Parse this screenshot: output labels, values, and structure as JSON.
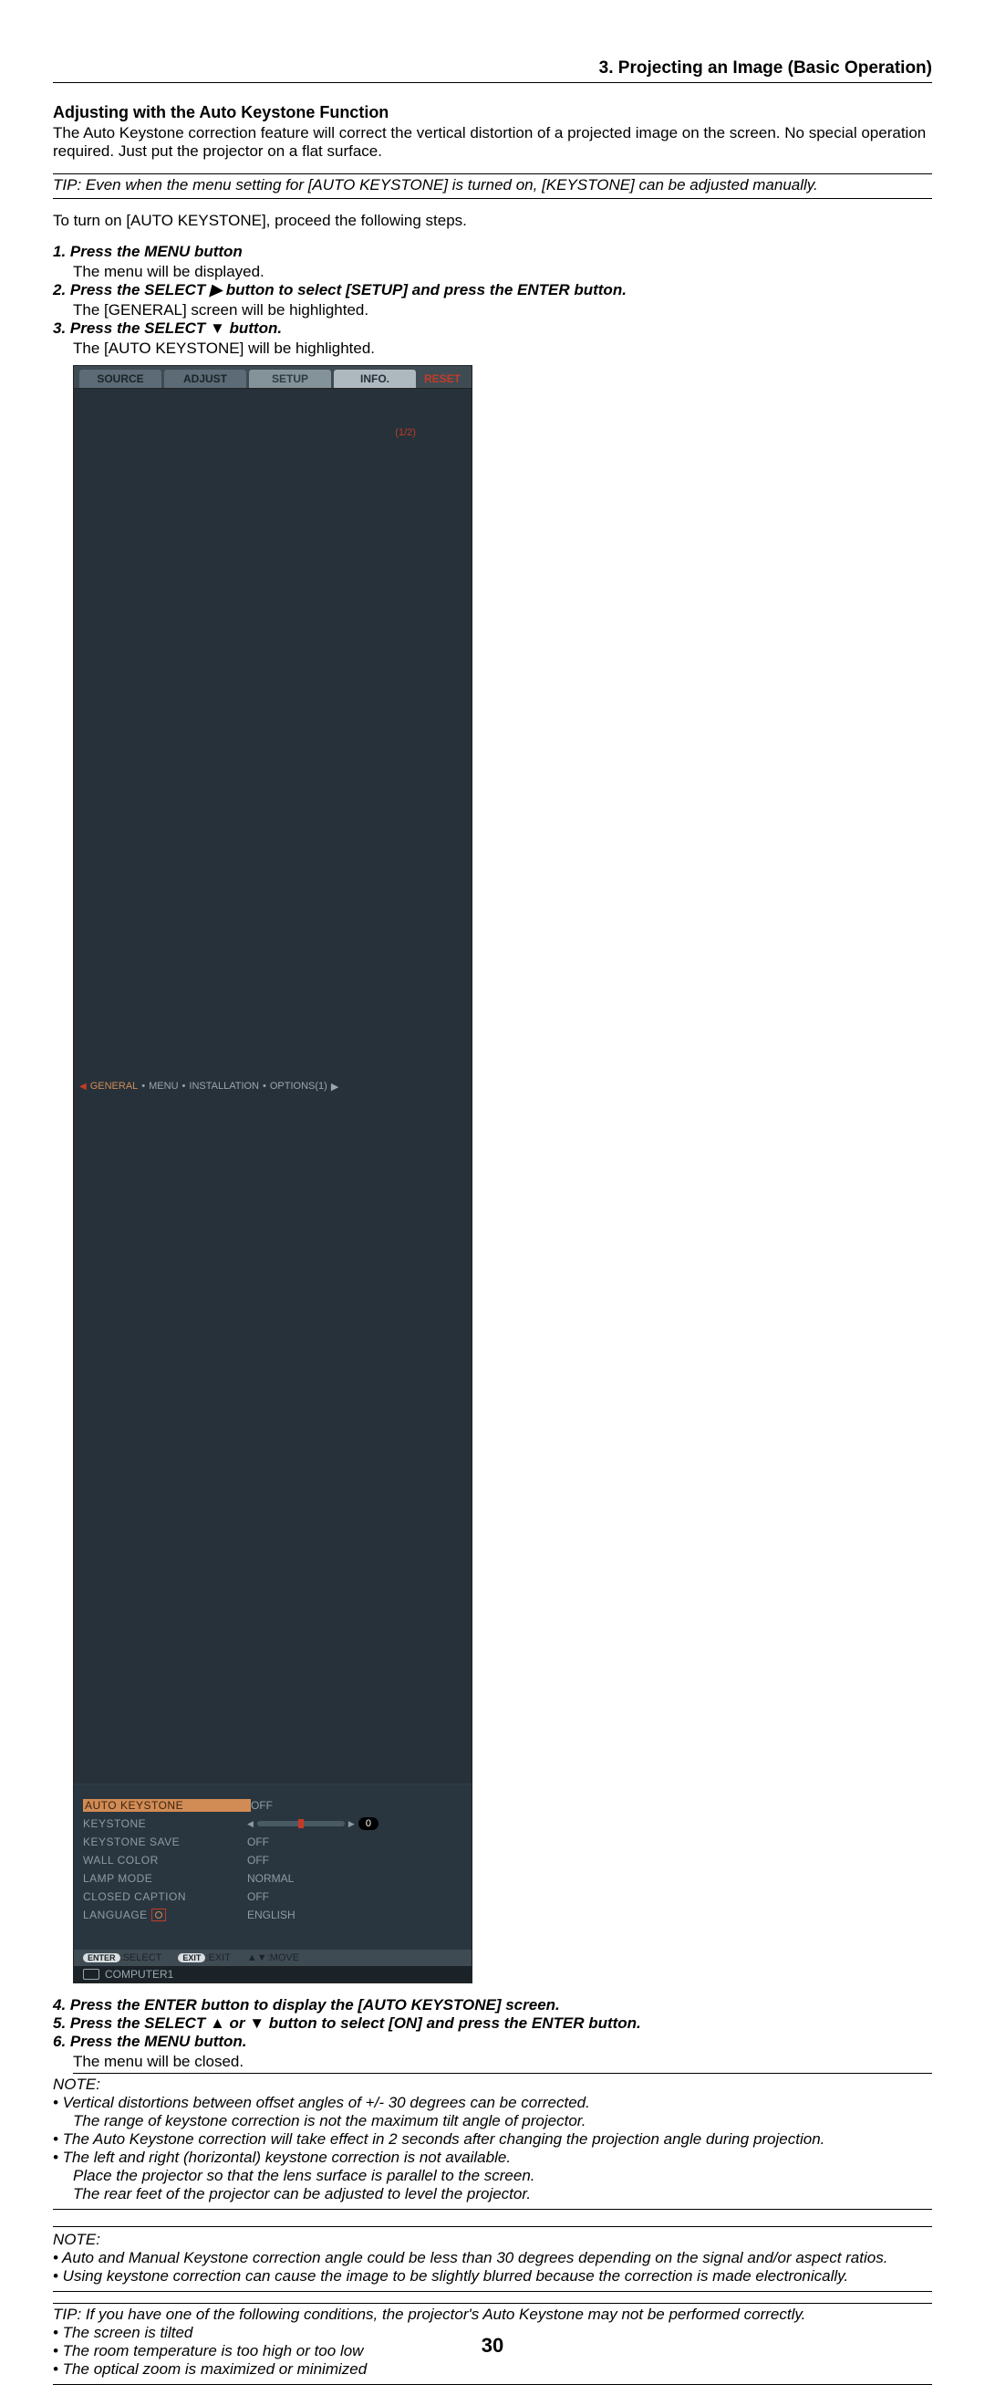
{
  "header": {
    "section": "3. Projecting an Image (Basic Operation)"
  },
  "section_title": "Adjusting with the Auto Keystone Function",
  "intro": "The Auto Keystone correction feature will correct the vertical distortion of a projected image on the screen. No special operation required. Just put the projector on a flat surface.",
  "tip1": "TIP: Even when the menu setting for [AUTO KEYSTONE] is turned on, [KEYSTONE] can be adjusted manually.",
  "lead_in": "To turn on [AUTO KEYSTONE], proceed the following steps.",
  "steps": {
    "s1": "1.  Press the MENU button",
    "s1_sub": "The menu will be displayed.",
    "s2": "2.  Press the SELECT ▶ button to select [SETUP] and press the ENTER button.",
    "s2_sub": "The [GENERAL] screen will be highlighted.",
    "s3": "3.  Press the SELECT ▼ button.",
    "s3_sub": "The [AUTO KEYSTONE] will be highlighted.",
    "s4": "4.  Press the ENTER button to display the [AUTO KEYSTONE] screen.",
    "s5": "5.  Press the SELECT ▲ or ▼ button to select [ON] and press the ENTER button.",
    "s6": "6.  Press the MENU button.",
    "s6_sub": "The menu will be closed."
  },
  "osd": {
    "tabs": {
      "source": "SOURCE",
      "adjust": "ADJUST",
      "setup": "SETUP",
      "info": "INFO.",
      "reset": "RESET"
    },
    "subtabs": {
      "arrow": "◀",
      "general": "GENERAL",
      "menu": "MENU",
      "install": "INSTALLATION",
      "options": "OPTIONS(1)",
      "arrow2": "▶",
      "page": "1/2"
    },
    "rows": {
      "auto_keystone": "AUTO KEYSTONE",
      "auto_keystone_v": "OFF",
      "keystone": "KEYSTONE",
      "keystone_v": "0",
      "keystone_save": "KEYSTONE SAVE",
      "keystone_save_v": "OFF",
      "wall_color": "WALL COLOR",
      "wall_color_v": "OFF",
      "lamp_mode": "LAMP MODE",
      "lamp_mode_v": "NORMAL",
      "closed_caption": "CLOSED CAPTION",
      "closed_caption_v": "OFF",
      "language": "LANGUAGE",
      "language_v": "ENGLISH"
    },
    "footer": {
      "enter": "ENTER",
      "select": ":SELECT",
      "exit": "EXIT",
      "exitlbl": ":EXIT",
      "move": ":MOVE",
      "arr": "▲▼"
    },
    "source": "COMPUTER1"
  },
  "note1": {
    "label": "NOTE:",
    "b1": "•  Vertical distortions between offset angles of +/- 30 degrees can be corrected.",
    "b1b": "The range of keystone correction is not the maximum tilt angle of projector.",
    "b2": "•  The Auto Keystone correction will take effect in 2 seconds after changing the projection angle during projection.",
    "b3": "•  The left and right (horizontal) keystone correction is not available.",
    "b3b": "Place the projector so that the lens surface is parallel to the screen.",
    "b3c": "The rear feet of the projector can be adjusted to level the projector."
  },
  "note2": {
    "label": "NOTE:",
    "b1": "•  Auto and Manual Keystone correction angle could be less than 30 degrees depending on the signal and/or aspect ratios.",
    "b2": "•  Using keystone correction can cause the image to be slightly blurred because the correction is made electronically."
  },
  "tip2": {
    "lead": "TIP: If you have one of the following conditions, the projector's Auto Keystone may not be performed correctly.",
    "b1": "•  The screen is tilted",
    "b2": "•  The room temperature is too high or too low",
    "b3": "•  The optical zoom is maximized or minimized"
  },
  "page_number": "30"
}
